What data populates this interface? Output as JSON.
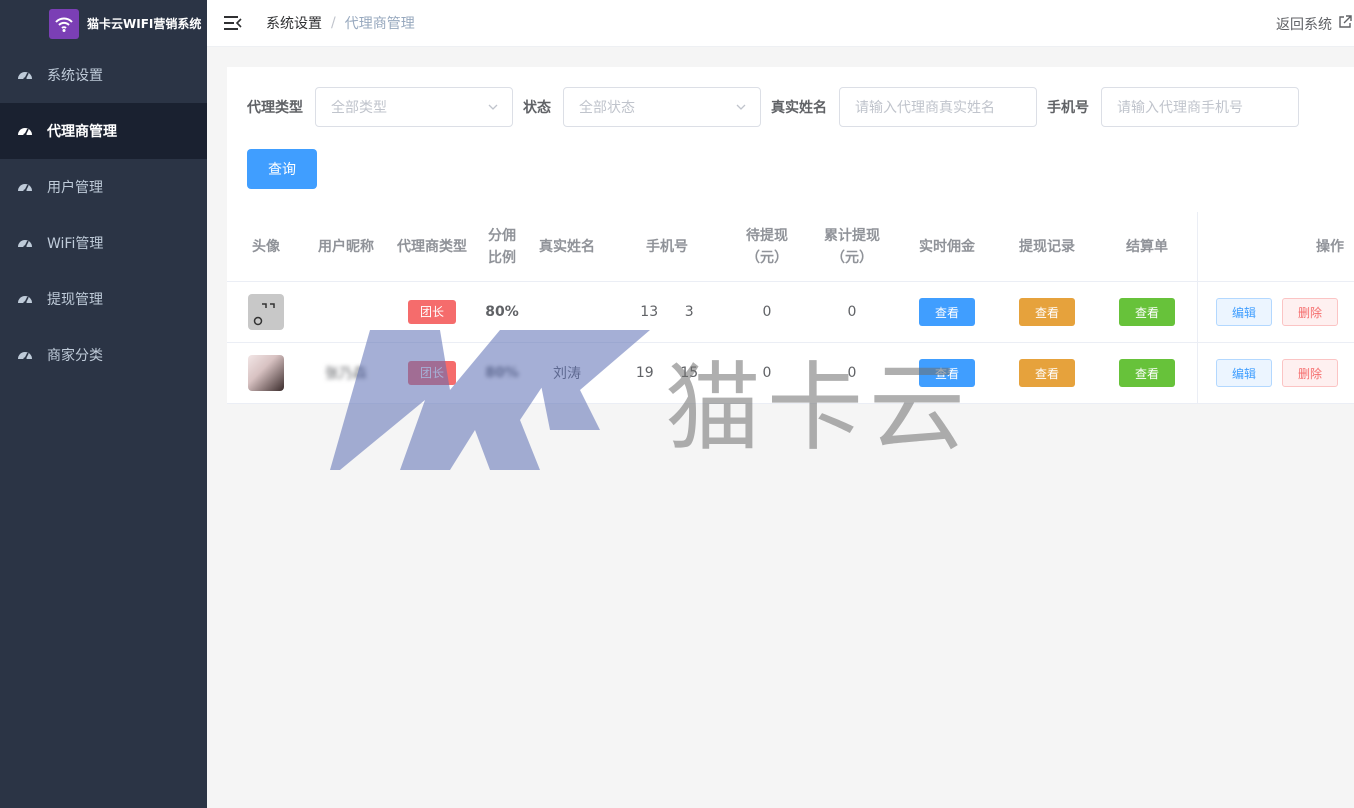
{
  "app": {
    "title": "猫卡云WIFI营销系统"
  },
  "sidebar": {
    "items": [
      {
        "label": "系统设置",
        "icon": "dashboard-icon",
        "active": false
      },
      {
        "label": "代理商管理",
        "icon": "dashboard-icon",
        "active": true
      },
      {
        "label": "用户管理",
        "icon": "dashboard-icon",
        "active": false
      },
      {
        "label": "WiFi管理",
        "icon": "dashboard-icon",
        "active": false
      },
      {
        "label": "提现管理",
        "icon": "dashboard-icon",
        "active": false
      },
      {
        "label": "商家分类",
        "icon": "dashboard-icon",
        "active": false
      }
    ]
  },
  "header": {
    "breadcrumb": [
      "系统设置",
      "代理商管理"
    ],
    "separator": "/",
    "return_label": "返回系统"
  },
  "filters": {
    "type_label": "代理类型",
    "type_placeholder": "全部类型",
    "status_label": "状态",
    "status_placeholder": "全部状态",
    "name_label": "真实姓名",
    "name_placeholder": "请输入代理商真实姓名",
    "phone_label": "手机号",
    "phone_placeholder": "请输入代理商手机号",
    "query_label": "查询"
  },
  "table": {
    "headers": {
      "avatar": "头像",
      "nickname": "用户昵称",
      "agent_type": "代理商类型",
      "ratio_1": "分佣",
      "ratio_2": "比例",
      "real_name": "真实姓名",
      "phone": "手机号",
      "pending_1": "待提现",
      "pending_2": "（元）",
      "total_1": "累计提现",
      "total_2": "（元）",
      "commission": "实时佣金",
      "records": "提现记录",
      "settlement": "结算单",
      "actions": "操作"
    },
    "rows": [
      {
        "nickname": "",
        "agent_type": "团长",
        "ratio": "80%",
        "real_name": "",
        "phone": "13      3",
        "pending": "0",
        "total": "0",
        "view": "查看",
        "edit": "编辑",
        "delete": "删除"
      },
      {
        "nickname": "张乃森",
        "agent_type": "团长",
        "ratio": "80%",
        "real_name": "刘涛",
        "phone": "19      15",
        "pending": "0",
        "total": "0",
        "view": "查看",
        "edit": "编辑",
        "delete": "删除"
      }
    ]
  },
  "watermark": {
    "text": "猫卡云",
    "logo": "MK"
  },
  "colors": {
    "primary": "#409eff",
    "warning": "#e6a23c",
    "success": "#67c23a",
    "danger": "#f56c6c",
    "sidebar": "#2b3445"
  }
}
